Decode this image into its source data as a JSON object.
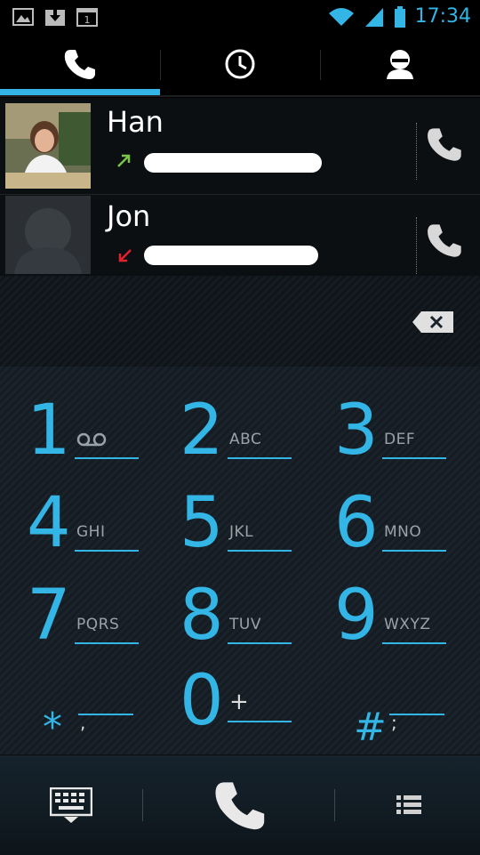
{
  "status_bar": {
    "time": "17:34",
    "accent": "#33b5e5",
    "left_icons": [
      "image-icon",
      "download-icon",
      "sim-icon"
    ],
    "sim_label": "1",
    "right_icons": [
      "wifi-icon",
      "signal-icon",
      "battery-icon"
    ]
  },
  "tabs": [
    {
      "name": "phone",
      "icon": "phone-icon",
      "selected": true
    },
    {
      "name": "recent",
      "icon": "clock-icon",
      "selected": false
    },
    {
      "name": "contacts",
      "icon": "person-icon",
      "selected": false
    }
  ],
  "contacts": [
    {
      "name": "Han",
      "direction": "outgoing",
      "direction_color": "#7cc34a",
      "number_redacted": true
    },
    {
      "name": "Jon",
      "direction": "missed",
      "direction_color": "#e0222c",
      "number_redacted": true
    }
  ],
  "keypad": {
    "keys": [
      {
        "digit": "1",
        "letters": "",
        "voicemail": true
      },
      {
        "digit": "2",
        "letters": "ABC"
      },
      {
        "digit": "3",
        "letters": "DEF"
      },
      {
        "digit": "4",
        "letters": "GHI"
      },
      {
        "digit": "5",
        "letters": "JKL"
      },
      {
        "digit": "6",
        "letters": "MNO"
      },
      {
        "digit": "7",
        "letters": "PQRS"
      },
      {
        "digit": "8",
        "letters": "TUV"
      },
      {
        "digit": "9",
        "letters": "WXYZ"
      },
      {
        "digit": "*",
        "letters": ","
      },
      {
        "digit": "0",
        "letters": "+"
      },
      {
        "digit": "#",
        "letters": ";"
      }
    ]
  },
  "bottom_bar": {
    "icons": [
      "keyboard-icon",
      "call-icon",
      "menu-icon"
    ]
  }
}
